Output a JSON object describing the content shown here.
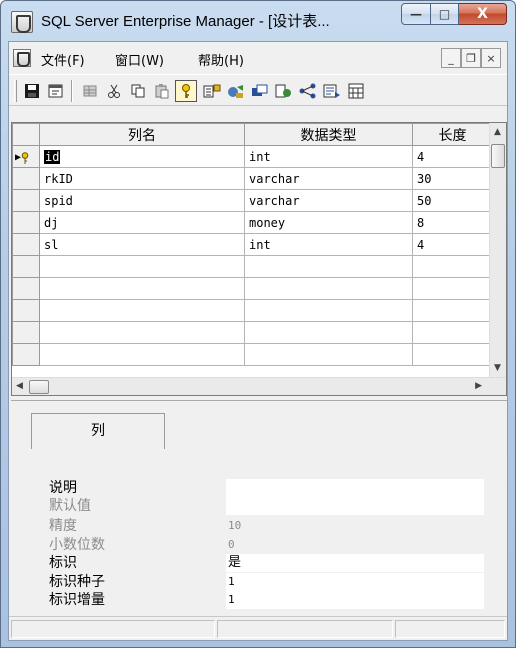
{
  "window": {
    "title": "SQL Server Enterprise Manager - [设计表...",
    "min_label": "—",
    "max_label": "□",
    "close_label": "X"
  },
  "menu": {
    "items": [
      "文件(F)",
      "窗口(W)",
      "帮助(H)"
    ],
    "mdi_min": "_",
    "mdi_restore": "❐",
    "mdi_close": "×"
  },
  "toolbar": {
    "icons": [
      "save-icon",
      "properties-icon",
      "table-icon",
      "cut-icon",
      "copy-icon",
      "paste-icon",
      "primary-key-icon",
      "manage-indexes-icon",
      "relationships-icon",
      "check-constraints-icon",
      "manage-triggers-icon",
      "dependencies-icon",
      "generate-script-icon",
      "grid-view-icon"
    ]
  },
  "grid": {
    "headers": [
      "列名",
      "数据类型",
      "长度"
    ],
    "rows": [
      {
        "name": "id",
        "type": "int",
        "length": "4",
        "pk": true
      },
      {
        "name": "rkID",
        "type": "varchar",
        "length": "30"
      },
      {
        "name": "spid",
        "type": "varchar",
        "length": "50"
      },
      {
        "name": "dj",
        "type": "money",
        "length": "8"
      },
      {
        "name": "sl",
        "type": "int",
        "length": "4"
      }
    ]
  },
  "properties": {
    "tab_label": "列",
    "rows": [
      {
        "label": "说明",
        "value": "",
        "enabled": true,
        "box": true
      },
      {
        "label": "默认值",
        "value": "",
        "enabled": false,
        "box": true
      },
      {
        "label": "精度",
        "value": "10",
        "enabled": false,
        "box": false
      },
      {
        "label": "小数位数",
        "value": "0",
        "enabled": false,
        "box": false
      },
      {
        "label": "标识",
        "value": "是",
        "enabled": true,
        "box": true
      },
      {
        "label": "标识种子",
        "value": "1",
        "enabled": true,
        "box": true
      },
      {
        "label": "标识增量",
        "value": "1",
        "enabled": true,
        "box": true
      }
    ]
  },
  "colors": {
    "selection": "#000000",
    "titlebar": "#b6cde6",
    "close": "#c24a2c"
  }
}
